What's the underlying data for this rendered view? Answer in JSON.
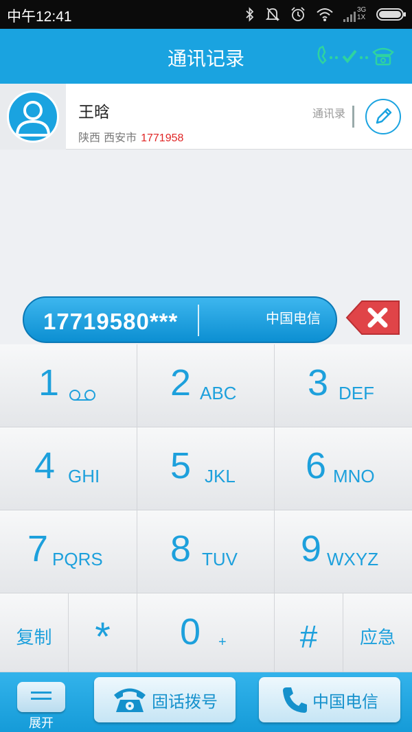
{
  "status_bar": {
    "time": "中午12:41",
    "network_label_top": "3G",
    "network_label_bottom": "1X"
  },
  "header": {
    "title": "通讯记录"
  },
  "contact": {
    "name": "王晗",
    "location": "陕西 西安市",
    "number": "1771958",
    "contacts_link": "通讯录"
  },
  "dialer": {
    "number": "17719580***",
    "carrier": "中国电信"
  },
  "keypad": {
    "keys": [
      {
        "digit": "1",
        "letters": ""
      },
      {
        "digit": "2",
        "letters": "ABC"
      },
      {
        "digit": "3",
        "letters": "DEF"
      },
      {
        "digit": "4",
        "letters": "GHI"
      },
      {
        "digit": "5",
        "letters": "JKL"
      },
      {
        "digit": "6",
        "letters": "MNO"
      },
      {
        "digit": "7",
        "letters": "PQRS"
      },
      {
        "digit": "8",
        "letters": "TUV"
      },
      {
        "digit": "9",
        "letters": "WXYZ"
      }
    ],
    "copy": "复制",
    "star": "*",
    "zero": "0",
    "plus": "+",
    "hash": "#",
    "emergency": "应急"
  },
  "bottom_bar": {
    "expand": "展开",
    "landline": "固话拨号",
    "mobile": "中国电信"
  },
  "colors": {
    "accent": "#1aa3e0",
    "key_text": "#1da0dc",
    "number_red": "#e02424",
    "delete_red": "#e04448"
  }
}
